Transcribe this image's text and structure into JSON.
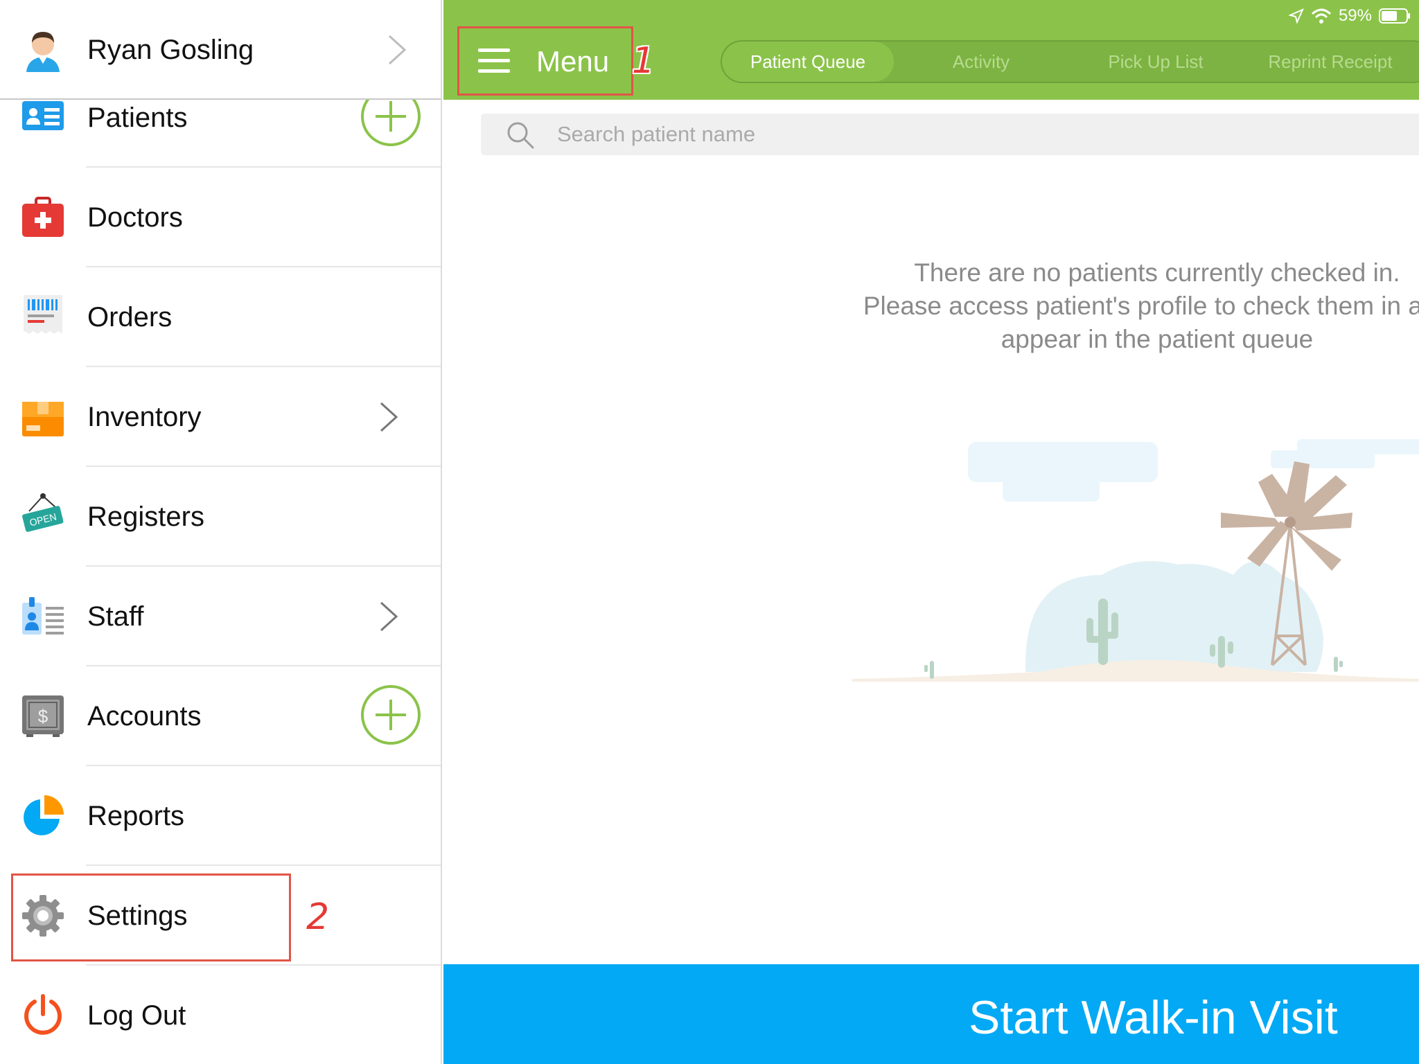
{
  "status_bar": {
    "battery": "59%"
  },
  "user": {
    "name": "Ryan Gosling"
  },
  "sidebar": {
    "items": [
      {
        "label": "Patients",
        "icon": "patients-card-icon",
        "accessory": "plus"
      },
      {
        "label": "Doctors",
        "icon": "medical-kit-icon",
        "accessory": "none"
      },
      {
        "label": "Orders",
        "icon": "barcode-receipt-icon",
        "accessory": "none"
      },
      {
        "label": "Inventory",
        "icon": "box-icon",
        "accessory": "chevron"
      },
      {
        "label": "Registers",
        "icon": "open-sign-icon",
        "sign_text": "OPEN",
        "accessory": "none"
      },
      {
        "label": "Staff",
        "icon": "id-badge-icon",
        "accessory": "chevron"
      },
      {
        "label": "Accounts",
        "icon": "safe-icon",
        "accessory": "plus"
      },
      {
        "label": "Reports",
        "icon": "pie-chart-icon",
        "accessory": "none"
      },
      {
        "label": "Settings",
        "icon": "gear-icon",
        "accessory": "none"
      },
      {
        "label": "Log Out",
        "icon": "power-icon",
        "accessory": "none"
      }
    ]
  },
  "header": {
    "menu_label": "Menu",
    "tabs": [
      {
        "label": "Patient Queue",
        "active": true
      },
      {
        "label": "Activity",
        "active": false
      },
      {
        "label": "Pick Up List",
        "active": false
      },
      {
        "label": "Reprint Receipt",
        "active": false
      }
    ]
  },
  "search": {
    "placeholder": "Search patient name"
  },
  "empty_state": {
    "line1": "There are no patients currently checked in.",
    "line2": "Please access patient's profile to check them in and",
    "line3": "appear in the patient queue"
  },
  "cta": {
    "label": "Start Walk-in Visit"
  },
  "annotations": {
    "step1": "1",
    "step2": "2"
  },
  "colors": {
    "brand_green": "#8bc34a",
    "cta_blue": "#03a9f4",
    "highlight_red": "#e05548"
  }
}
